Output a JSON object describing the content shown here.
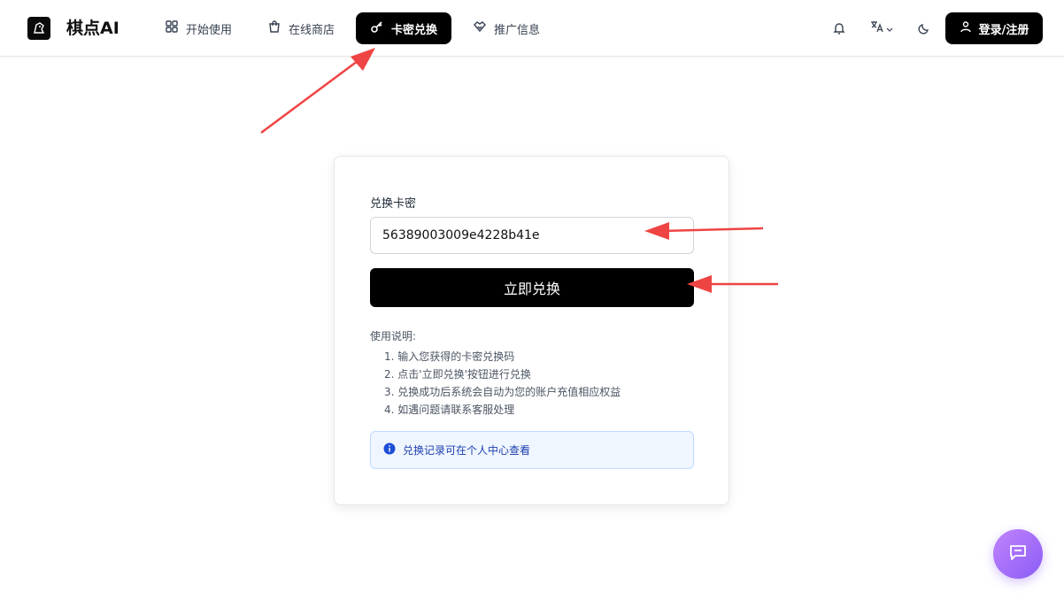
{
  "header": {
    "brand": "棋点AI",
    "nav": [
      {
        "label": "开始使用",
        "icon": "grid-icon"
      },
      {
        "label": "在线商店",
        "icon": "shopping-bag-icon"
      },
      {
        "label": "卡密兑换",
        "icon": "key-icon",
        "active": true
      },
      {
        "label": "推广信息",
        "icon": "handshake-icon"
      }
    ],
    "login_label": "登录/注册"
  },
  "redeem": {
    "field_label": "兑换卡密",
    "code_value": "56389003009e4228b41e",
    "button_label": "立即兑换",
    "usage_title": "使用说明:",
    "usage_steps": [
      "1. 输入您获得的卡密兑换码",
      "2. 点击'立即兑换'按钮进行兑换",
      "3. 兑换成功后系统会自动为您的账户充值相应权益",
      "4. 如遇问题请联系客服处理"
    ],
    "info_text": "兑换记录可在个人中心查看"
  },
  "colors": {
    "accent": "#000000",
    "annotation_arrow": "#ef4444",
    "info_bg": "#eff6ff",
    "info_text": "#1e40af",
    "chat_fab": "#a855f7"
  }
}
